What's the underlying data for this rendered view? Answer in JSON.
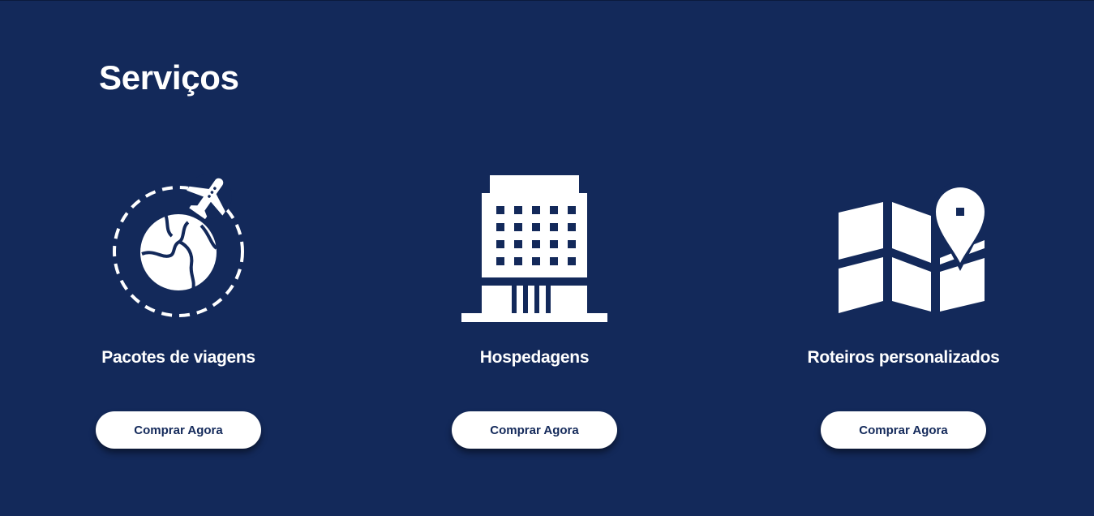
{
  "section": {
    "title": "Serviços"
  },
  "services": [
    {
      "icon": "globe-airplane-icon",
      "title": "Pacotes de viagens",
      "button_label": "Comprar Agora"
    },
    {
      "icon": "hotel-building-icon",
      "title": "Hospedagens",
      "button_label": "Comprar Agora"
    },
    {
      "icon": "map-pin-icon",
      "title": "Roteiros personalizados",
      "button_label": "Comprar Agora"
    }
  ],
  "colors": {
    "background": "#13295a",
    "text": "#ffffff",
    "button_bg": "#ffffff",
    "button_text": "#13295a"
  }
}
